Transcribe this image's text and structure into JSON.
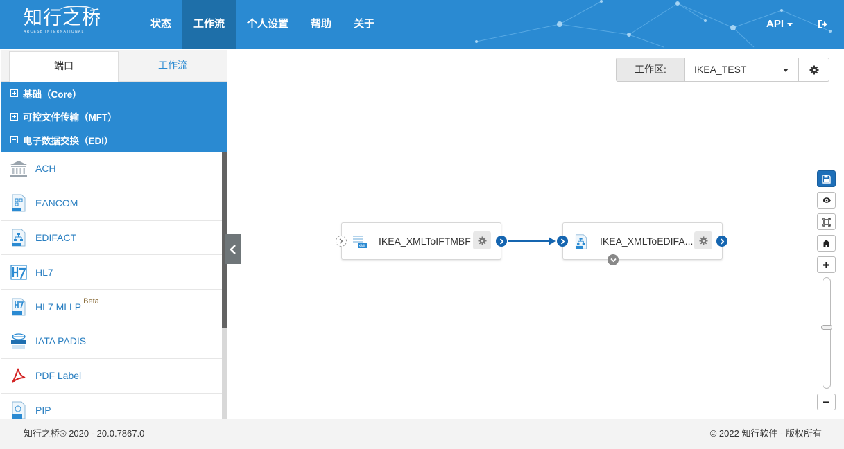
{
  "brand": {
    "logo_text": "知行之桥",
    "logo_subtext": "ARCESB INTERNATIONAL"
  },
  "nav": {
    "items": [
      {
        "label": "状态"
      },
      {
        "label": "工作流"
      },
      {
        "label": "个人设置"
      },
      {
        "label": "帮助"
      },
      {
        "label": "关于"
      }
    ],
    "active": "工作流",
    "api_label": "API"
  },
  "sidebar": {
    "tabs": [
      {
        "label": "端口"
      },
      {
        "label": "工作流"
      }
    ],
    "active_tab": "端口",
    "groups": [
      {
        "label": "基础（Core）",
        "expanded": false
      },
      {
        "label": "可控文件传输（MFT）",
        "expanded": false
      },
      {
        "label": "电子数据交换（EDI）",
        "expanded": true
      }
    ],
    "items": [
      {
        "label": "ACH",
        "icon": "bank-icon"
      },
      {
        "label": "EANCOM",
        "icon": "eancom-doc-icon"
      },
      {
        "label": "EDIFACT",
        "icon": "edifact-doc-icon"
      },
      {
        "label": "HL7",
        "icon": "hl7-icon"
      },
      {
        "label": "HL7 MLLP",
        "badge": "Beta",
        "icon": "hl7-mllp-doc-icon"
      },
      {
        "label": "IATA PADIS",
        "icon": "iata-icon"
      },
      {
        "label": "PDF Label",
        "icon": "pdf-icon"
      },
      {
        "label": "PIP",
        "icon": "pip-doc-icon"
      }
    ]
  },
  "workspace": {
    "label": "工作区:",
    "value": "IKEA_TEST"
  },
  "flow": {
    "nodes": [
      {
        "title": "IKEA_XMLToIFTMBF",
        "icon": "xml-icon"
      },
      {
        "title": "IKEA_XMLToEDIFA...",
        "icon": "edifact-doc-icon"
      }
    ]
  },
  "tools": [
    {
      "name": "save-icon"
    },
    {
      "name": "eye-icon"
    },
    {
      "name": "fit-screen-icon"
    },
    {
      "name": "home-icon"
    },
    {
      "name": "zoom-in-icon"
    }
  ],
  "zoom": {
    "level": 0.55
  },
  "footer": {
    "version": "知行之桥® 2020 - 20.0.7867.0",
    "copyright": "© 2022 知行软件 - 版权所有"
  },
  "colors": {
    "primary": "#2a8ad2",
    "nav_active": "#1e6fa9",
    "port": "#1565b0",
    "link": "#2a7fc1"
  }
}
